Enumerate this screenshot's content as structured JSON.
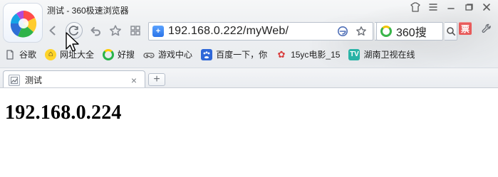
{
  "window": {
    "title": "测试 - 360极速浏览器"
  },
  "nav": {
    "address": "192.168.0.222/myWeb/",
    "search_text": "360搜"
  },
  "bookmarks": [
    {
      "label": "谷歌",
      "icon": "doc-icon"
    },
    {
      "label": "网址大全",
      "icon": "home-icon"
    },
    {
      "label": "好搜",
      "icon": "search-circle-icon"
    },
    {
      "label": "游戏中心",
      "icon": "gamepad-icon"
    },
    {
      "label": "百度一下，你",
      "icon": "baidu-paw-icon"
    },
    {
      "label": "15yc电影_15",
      "icon": "flower-icon"
    },
    {
      "label": "湖南卫视在线",
      "icon": "tv-icon"
    }
  ],
  "tabs": [
    {
      "title": "测试",
      "icon": "page-icon",
      "active": true
    }
  ],
  "page": {
    "heading": "192.168.0.224"
  },
  "toolbar": {
    "red_badge_text": "票"
  }
}
